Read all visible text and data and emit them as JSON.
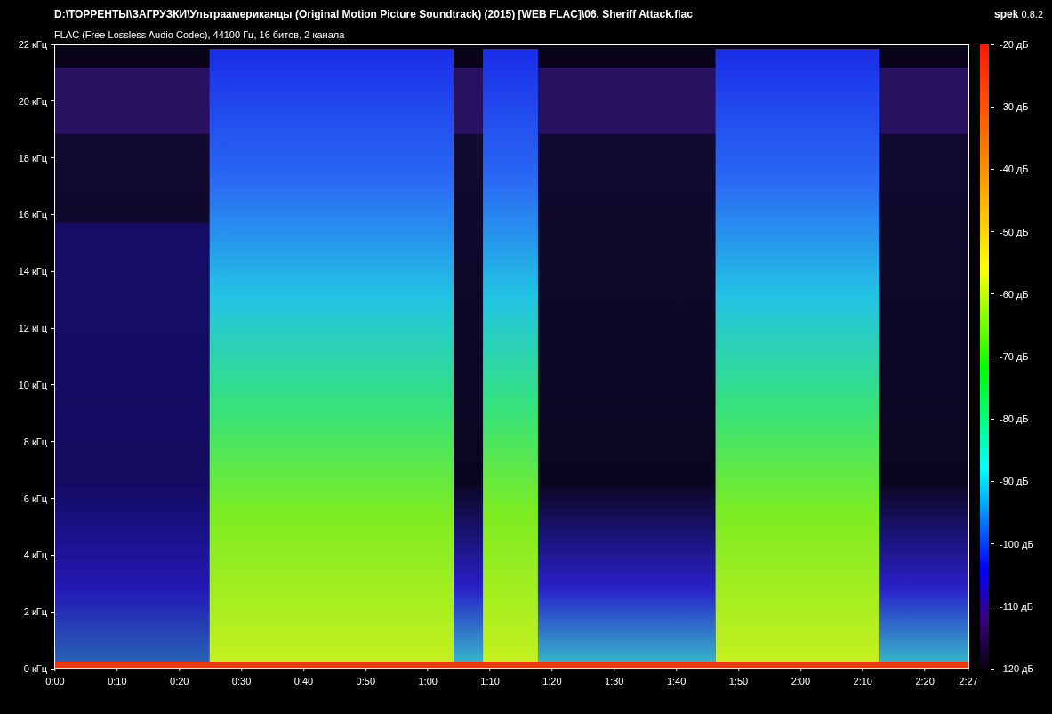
{
  "header": {
    "file_path": "D:\\ТОРРЕНТЫ\\ЗАГРУЗКИ\\Ультраамериканцы (Original Motion Picture Soundtrack) (2015) [WEB FLAC]\\06. Sheriff Attack.flac",
    "app_name": "spek",
    "app_version": "0.8.2",
    "audio_info": "FLAC (Free Lossless Audio Codec), 44100 Гц, 16 битов, 2 канала"
  },
  "frequency_axis": [
    "22 кГц",
    "20 кГц",
    "18 кГц",
    "16 кГц",
    "14 кГц",
    "12 кГц",
    "10 кГц",
    "8 кГц",
    "6 кГц",
    "4 кГц",
    "2 кГц",
    "0 кГц"
  ],
  "time_axis": [
    "0:00",
    "0:10",
    "0:20",
    "0:30",
    "0:40",
    "0:50",
    "1:00",
    "1:10",
    "1:20",
    "1:30",
    "1:40",
    "1:50",
    "2:00",
    "2:10",
    "2:20",
    "2:27"
  ],
  "level_scale": [
    "-20 дБ",
    "-30 дБ",
    "-40 дБ",
    "-50 дБ",
    "-60 дБ",
    "-70 дБ",
    "-80 дБ",
    "-90 дБ",
    "-100 дБ",
    "-110 дБ",
    "-120 дБ"
  ]
}
